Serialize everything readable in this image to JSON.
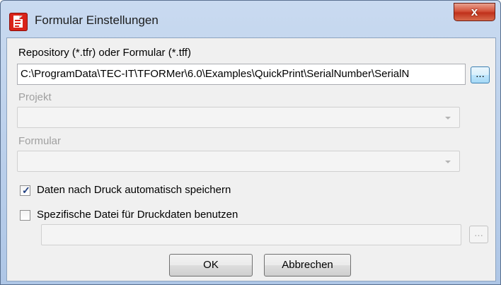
{
  "window": {
    "title": "Formular Einstellungen",
    "close_glyph": "x"
  },
  "repository": {
    "label": "Repository (*.tfr) oder Formular (*.tff)",
    "value": "C:\\ProgramData\\TEC-IT\\TFORMer\\6.0\\Examples\\QuickPrint\\SerialNumber\\SerialN",
    "browse_label": "..."
  },
  "project": {
    "label": "Projekt",
    "value": ""
  },
  "form": {
    "label": "Formular",
    "value": ""
  },
  "autosave": {
    "label": "Daten nach Druck automatisch speichern",
    "checked": true,
    "check_glyph": "✓"
  },
  "specific_file": {
    "label": "Spezifische Datei für Druckdaten benutzen",
    "checked": false,
    "value": "",
    "browse_label": "..."
  },
  "buttons": {
    "ok": "OK",
    "cancel": "Abbrechen"
  }
}
